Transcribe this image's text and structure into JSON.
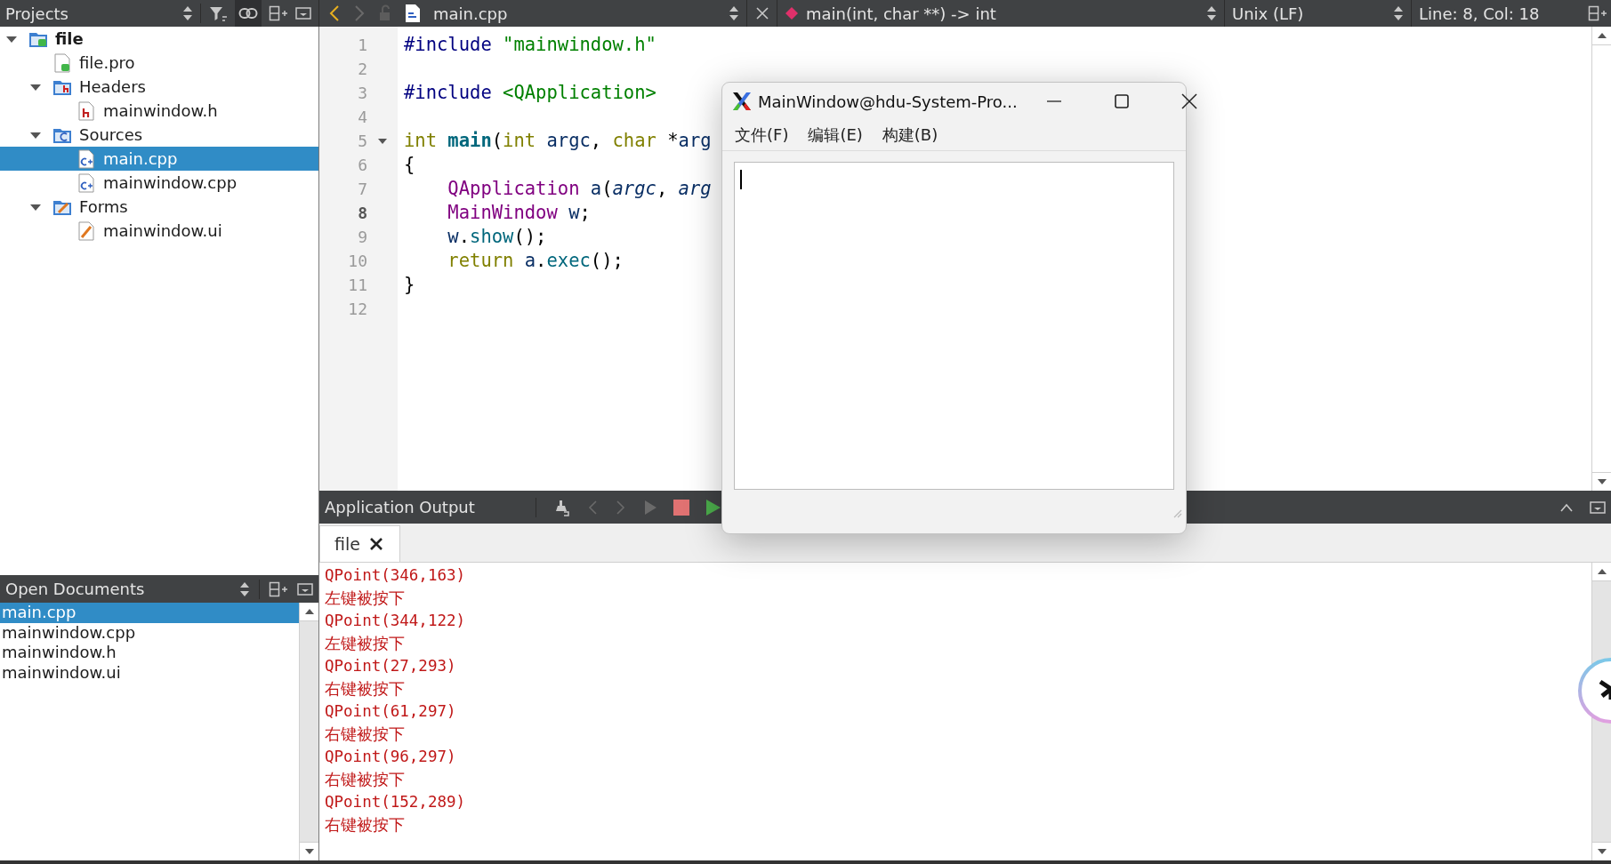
{
  "toolbar": {
    "panel_title": "Projects",
    "back_enabled": true,
    "forward_enabled": false,
    "document": "main.cpp",
    "symbol": "main(int, char **) -> int",
    "line_endings": "Unix (LF)",
    "cursor_position": "Line: 8, Col: 18"
  },
  "project_tree": [
    {
      "label": "file",
      "kind": "project",
      "expanded": true,
      "selected": false,
      "children": [
        {
          "label": "file.pro",
          "kind": "pro-file",
          "selected": false
        },
        {
          "label": "Headers",
          "kind": "header-folder",
          "expanded": true,
          "selected": false,
          "children": [
            {
              "label": "mainwindow.h",
              "kind": "header-file",
              "selected": false
            }
          ]
        },
        {
          "label": "Sources",
          "kind": "source-folder",
          "expanded": true,
          "selected": false,
          "children": [
            {
              "label": "main.cpp",
              "kind": "source-file",
              "selected": true
            },
            {
              "label": "mainwindow.cpp",
              "kind": "source-file",
              "selected": false
            }
          ]
        },
        {
          "label": "Forms",
          "kind": "form-folder",
          "expanded": true,
          "selected": false,
          "children": [
            {
              "label": "mainwindow.ui",
              "kind": "form-file",
              "selected": false
            }
          ]
        }
      ]
    }
  ],
  "open_documents": {
    "title": "Open Documents",
    "items": [
      {
        "name": "main.cpp",
        "selected": true
      },
      {
        "name": "mainwindow.cpp",
        "selected": false
      },
      {
        "name": "mainwindow.h",
        "selected": false
      },
      {
        "name": "mainwindow.ui",
        "selected": false
      }
    ]
  },
  "editor": {
    "lines": [
      {
        "number": "1",
        "current": false,
        "tokens": [
          {
            "t": "#include",
            "kind": "preproc"
          },
          {
            "t": " \"mainwindow.h\"",
            "kind": "string"
          }
        ]
      },
      {
        "number": "2",
        "current": false
      },
      {
        "number": "3",
        "current": false,
        "tokens": [
          {
            "t": "#include",
            "kind": "preproc"
          },
          {
            "t": " <QApplication>",
            "kind": "string"
          }
        ]
      },
      {
        "number": "4",
        "current": false
      },
      {
        "number": "5",
        "current": false,
        "foldable": true,
        "tokens": [
          {
            "t": "int",
            "kind": "keyword"
          },
          {
            "t": " main",
            "kind": "function"
          },
          {
            "t": "(",
            "kind": "plain"
          },
          {
            "t": "int",
            "kind": "keyword"
          },
          {
            "t": " argc",
            "kind": "local"
          },
          {
            "t": ",",
            "kind": "plain"
          },
          {
            "t": " char",
            "kind": "keyword"
          },
          {
            "t": " *",
            "kind": "plain"
          },
          {
            "t": "arg",
            "kind": "local"
          }
        ]
      },
      {
        "number": "6",
        "current": false,
        "tokens": [
          {
            "t": "{",
            "kind": "plain"
          }
        ]
      },
      {
        "number": "7",
        "current": false,
        "tokens": [
          {
            "t": "    QApplication",
            "kind": "type"
          },
          {
            "t": " a",
            "kind": "local"
          },
          {
            "t": "(",
            "kind": "plain"
          },
          {
            "t": "argc",
            "kind": "param"
          },
          {
            "t": ",",
            "kind": "plain"
          },
          {
            "t": " arg",
            "kind": "param"
          }
        ]
      },
      {
        "number": "8",
        "current": true,
        "tokens": [
          {
            "t": "    MainWindow",
            "kind": "type"
          },
          {
            "t": " w",
            "kind": "local"
          },
          {
            "t": ";",
            "kind": "plain"
          }
        ]
      },
      {
        "number": "9",
        "current": false,
        "tokens": [
          {
            "t": "    w",
            "kind": "local"
          },
          {
            "t": ".",
            "kind": "plain"
          },
          {
            "t": "show",
            "kind": "method"
          },
          {
            "t": "();",
            "kind": "plain"
          }
        ]
      },
      {
        "number": "10",
        "current": false,
        "tokens": [
          {
            "t": "    return",
            "kind": "keyword"
          },
          {
            "t": " a",
            "kind": "local"
          },
          {
            "t": ".",
            "kind": "plain"
          },
          {
            "t": "exec",
            "kind": "method"
          },
          {
            "t": "();",
            "kind": "plain"
          }
        ]
      },
      {
        "number": "11",
        "current": false,
        "tokens": [
          {
            "t": "}",
            "kind": "plain"
          }
        ]
      },
      {
        "number": "12",
        "current": false
      }
    ]
  },
  "output": {
    "title": "Application Output",
    "tabs": [
      {
        "label": "file",
        "selected": true
      }
    ],
    "lines": [
      {
        "text": "QPoint(346,163)"
      },
      {
        "text": "左键被按下"
      },
      {
        "text": "QPoint(344,122)"
      },
      {
        "text": "左键被按下"
      },
      {
        "text": "QPoint(27,293)"
      },
      {
        "text": "右键被按下"
      },
      {
        "text": "QPoint(61,297)"
      },
      {
        "text": "右键被按下"
      },
      {
        "text": "QPoint(96,297)"
      },
      {
        "text": "右键被按下"
      },
      {
        "text": "QPoint(152,289)"
      },
      {
        "text": "右键被按下"
      }
    ]
  },
  "app_window": {
    "title": "MainWindow@hdu-System-Pro...",
    "menus": [
      "文件(F)",
      "编辑(E)",
      "构建(B)"
    ]
  }
}
